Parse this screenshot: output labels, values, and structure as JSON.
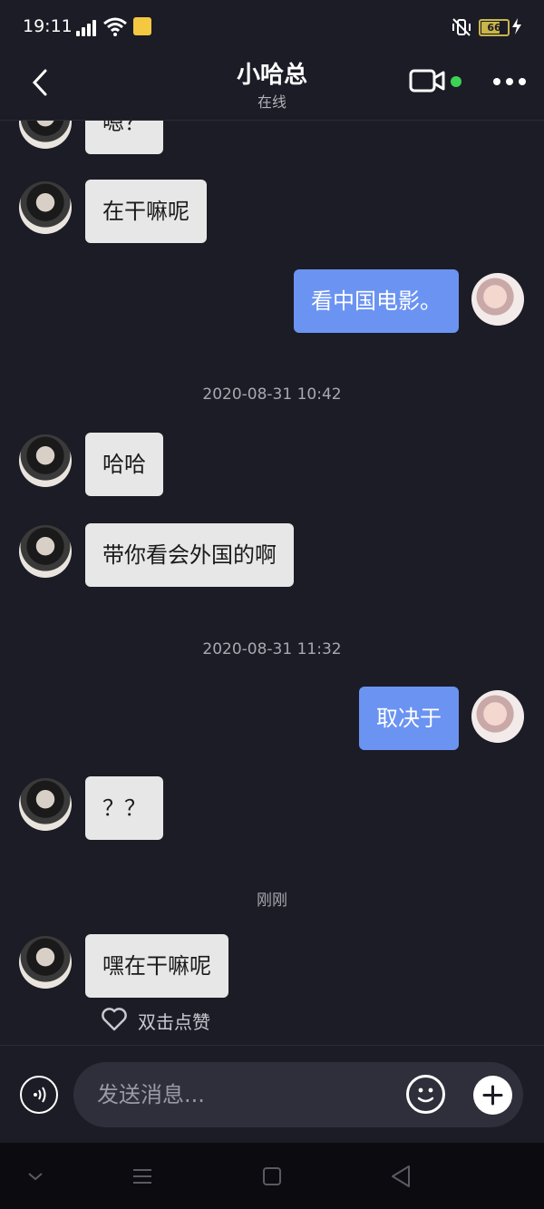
{
  "status_bar": {
    "time": "19:11",
    "battery": "66",
    "icons": [
      "signal-icon",
      "wifi-icon",
      "app-notification-icon",
      "mute-icon",
      "battery-icon",
      "charging-icon"
    ]
  },
  "header": {
    "title": "小哈总",
    "subtitle": "在线",
    "icons": [
      "back-icon",
      "video-call-icon",
      "more-icon"
    ],
    "online_color": "#3ed255"
  },
  "messages": [
    {
      "side": "in",
      "text": "嗯？"
    },
    {
      "side": "in",
      "text": "在干嘛呢"
    },
    {
      "side": "out",
      "text": "看中国电影。"
    },
    {
      "type": "time",
      "text": "2020-08-31 10:42"
    },
    {
      "side": "in",
      "text": "哈哈"
    },
    {
      "side": "in",
      "text": "带你看会外国的啊"
    },
    {
      "type": "time",
      "text": "2020-08-31 11:32"
    },
    {
      "side": "out",
      "text": "取决于"
    },
    {
      "side": "in",
      "text": "？？"
    },
    {
      "type": "time",
      "text": "刚刚"
    },
    {
      "side": "in",
      "text": "嘿在干嘛呢"
    }
  ],
  "like_hint": "双击点赞",
  "input": {
    "placeholder": "发送消息..."
  },
  "colors": {
    "background": "#1c1c26",
    "outgoing_bubble": "#6b93f2",
    "incoming_bubble": "#e7e7e7"
  }
}
